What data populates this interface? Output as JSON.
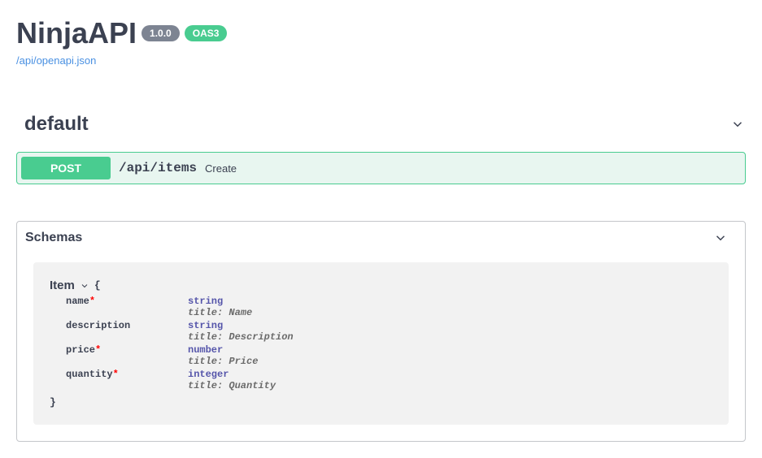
{
  "header": {
    "title": "NinjaAPI",
    "version": "1.0.0",
    "oas": "OAS3",
    "spec_link": "/api/openapi.json"
  },
  "tag": {
    "name": "default"
  },
  "operation": {
    "method": "POST",
    "path": "/api/items",
    "summary": "Create"
  },
  "schemas": {
    "title": "Schemas",
    "model": {
      "name": "Item",
      "props": [
        {
          "name": "name",
          "required": true,
          "type": "string",
          "title": "title: Name"
        },
        {
          "name": "description",
          "required": false,
          "type": "string",
          "title": "title: Description"
        },
        {
          "name": "price",
          "required": true,
          "type": "number",
          "title": "title: Price"
        },
        {
          "name": "quantity",
          "required": true,
          "type": "integer",
          "title": "title: Quantity"
        }
      ]
    }
  }
}
